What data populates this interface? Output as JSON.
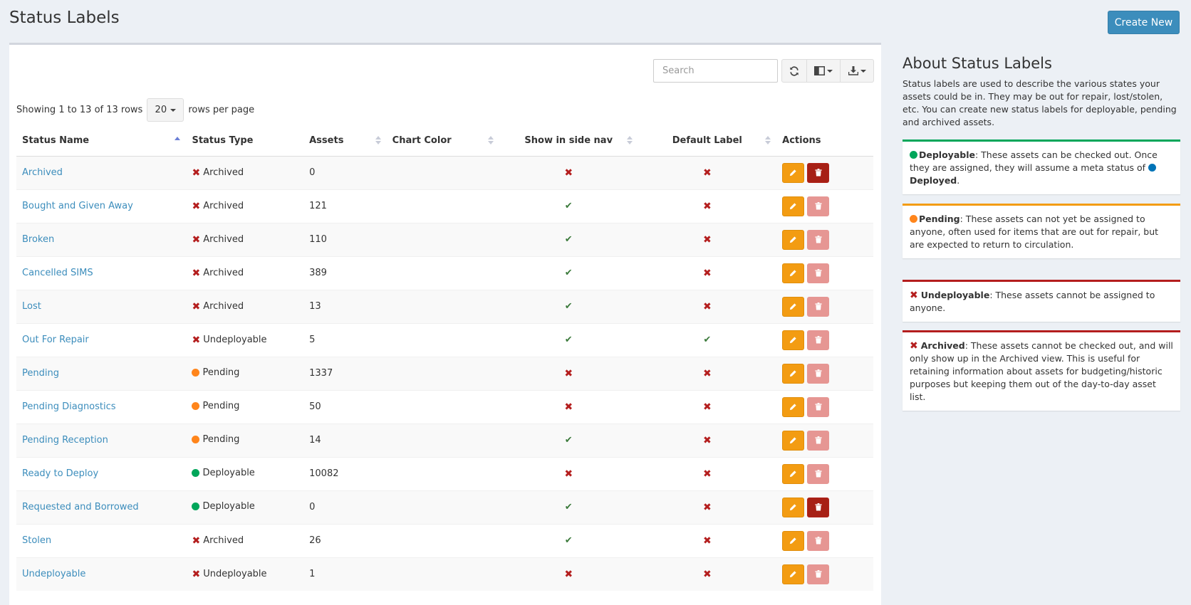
{
  "page": {
    "title": "Status Labels",
    "create_button": "Create New"
  },
  "toolbar": {
    "search_placeholder": "Search",
    "icons": [
      "refresh-icon",
      "columns-icon",
      "export-icon"
    ]
  },
  "pagination": {
    "info": "Showing 1 to 13 of 13 rows",
    "page_size": "20",
    "suffix": "rows per page"
  },
  "table": {
    "columns": [
      "Status Name",
      "Status Type",
      "Assets",
      "Chart Color",
      "Show in side nav",
      "Default Label",
      "Actions"
    ],
    "sorted_column": "Status Name",
    "rows": [
      {
        "name": "Archived",
        "type": "Archived",
        "type_icon": "x",
        "assets": "0",
        "side_nav": false,
        "default": false,
        "delete_enabled": true
      },
      {
        "name": "Bought and Given Away",
        "type": "Archived",
        "type_icon": "x",
        "assets": "121",
        "side_nav": true,
        "default": false,
        "delete_enabled": false
      },
      {
        "name": "Broken",
        "type": "Archived",
        "type_icon": "x",
        "assets": "110",
        "side_nav": true,
        "default": false,
        "delete_enabled": false
      },
      {
        "name": "Cancelled SIMS",
        "type": "Archived",
        "type_icon": "x",
        "assets": "389",
        "side_nav": true,
        "default": false,
        "delete_enabled": false
      },
      {
        "name": "Lost",
        "type": "Archived",
        "type_icon": "x",
        "assets": "13",
        "side_nav": true,
        "default": false,
        "delete_enabled": false
      },
      {
        "name": "Out For Repair",
        "type": "Undeployable",
        "type_icon": "x",
        "assets": "5",
        "side_nav": true,
        "default": true,
        "delete_enabled": false
      },
      {
        "name": "Pending",
        "type": "Pending",
        "type_icon": "orange",
        "assets": "1337",
        "side_nav": false,
        "default": false,
        "delete_enabled": false
      },
      {
        "name": "Pending Diagnostics",
        "type": "Pending",
        "type_icon": "orange",
        "assets": "50",
        "side_nav": false,
        "default": false,
        "delete_enabled": false
      },
      {
        "name": "Pending Reception",
        "type": "Pending",
        "type_icon": "orange",
        "assets": "14",
        "side_nav": true,
        "default": false,
        "delete_enabled": false
      },
      {
        "name": "Ready to Deploy",
        "type": "Deployable",
        "type_icon": "green",
        "assets": "10082",
        "side_nav": false,
        "default": false,
        "delete_enabled": false
      },
      {
        "name": "Requested and Borrowed",
        "type": "Deployable",
        "type_icon": "green",
        "assets": "0",
        "side_nav": true,
        "default": false,
        "delete_enabled": true
      },
      {
        "name": "Stolen",
        "type": "Archived",
        "type_icon": "x",
        "assets": "26",
        "side_nav": true,
        "default": false,
        "delete_enabled": false
      },
      {
        "name": "Undeployable",
        "type": "Undeployable",
        "type_icon": "x",
        "assets": "1",
        "side_nav": false,
        "default": false,
        "delete_enabled": false
      }
    ]
  },
  "about": {
    "title": "About Status Labels",
    "intro": "Status labels are used to describe the various states your assets could be in. They may be out for repair, lost/stolen, etc. You can create new status labels for deployable, pending and archived assets.",
    "deployable": {
      "label": "Deployable",
      "text": ": These assets can be checked out. Once they are assigned, they will assume a meta status of ",
      "deployed": "Deployed",
      "end": "."
    },
    "pending": {
      "label": "Pending",
      "text": ": These assets can not yet be assigned to anyone, often used for items that are out for repair, but are expected to return to circulation."
    },
    "undeployable": {
      "label": "Undeployable",
      "text": ": These assets cannot be assigned to anyone."
    },
    "archived": {
      "label": "Archived",
      "text": ": These assets cannot be checked out, and will only show up in the Archived view. This is useful for retaining information about assets for budgeting/historic purposes but keeping them out of the day-to-day asset list."
    }
  },
  "colors": {
    "accent": "#3c8dbc",
    "edit": "#f39c12",
    "delete": "#a72015",
    "deployable": "#00a65a",
    "pending": "#ff851b",
    "deployed": "#0073b7",
    "archived": "#b41e1e"
  }
}
